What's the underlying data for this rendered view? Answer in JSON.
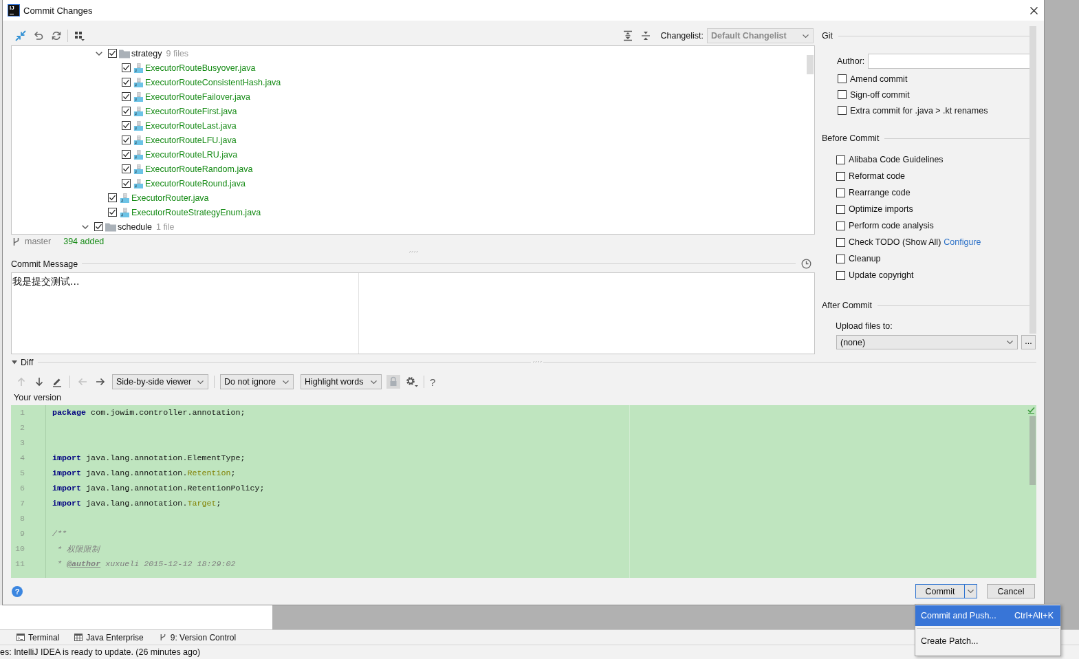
{
  "window": {
    "logo_text": "IJ",
    "title": "Commit Changes"
  },
  "changes": {
    "changelist_label": "Changelist:",
    "changelist": "Default Changelist",
    "tree": [
      {
        "children": [
          {
            "kind": "folder",
            "label": "strategy",
            "count": "9 files",
            "checked": true,
            "expanded": true,
            "children": [
              {
                "kind": "file",
                "label": "ExecutorRouteBusyover.java",
                "checked": true
              },
              {
                "kind": "file",
                "label": "ExecutorRouteConsistentHash.java",
                "checked": true
              },
              {
                "kind": "file",
                "label": "ExecutorRouteFailover.java",
                "checked": true
              },
              {
                "kind": "file",
                "label": "ExecutorRouteFirst.java",
                "checked": true
              },
              {
                "kind": "file",
                "label": "ExecutorRouteLast.java",
                "checked": true
              },
              {
                "kind": "file",
                "label": "ExecutorRouteLFU.java",
                "checked": true
              },
              {
                "kind": "file",
                "label": "ExecutorRouteLRU.java",
                "checked": true
              },
              {
                "kind": "file",
                "label": "ExecutorRouteRandom.java",
                "checked": true
              },
              {
                "kind": "file",
                "label": "ExecutorRouteRound.java",
                "checked": true
              }
            ]
          },
          {
            "kind": "file",
            "label": "ExecutorRouter.java",
            "checked": true
          },
          {
            "kind": "file",
            "label": "ExecutorRouteStrategyEnum.java",
            "checked": true
          }
        ]
      },
      {
        "kind": "folder",
        "label": "schedule",
        "count": "1 file",
        "checked": true,
        "expanded": true
      }
    ],
    "branch": "master",
    "summary": "394 added"
  },
  "commit_message": {
    "label": "Commit Message",
    "value": "我是提交测试..."
  },
  "git": {
    "title": "Git",
    "author_label": "Author:",
    "options": [
      {
        "label": "Amend commit",
        "checked": false
      },
      {
        "label": "Sign-off commit",
        "checked": false
      },
      {
        "label": "Extra commit for .java > .kt renames",
        "checked": false
      }
    ]
  },
  "before_commit": {
    "title": "Before Commit",
    "options": [
      {
        "label": "Alibaba Code Guidelines",
        "checked": false
      },
      {
        "label": "Reformat code",
        "checked": false
      },
      {
        "label": "Rearrange code",
        "checked": false
      },
      {
        "label": "Optimize imports",
        "checked": false
      },
      {
        "label": "Perform code analysis",
        "checked": false
      },
      {
        "label": "Check TODO (Show All)",
        "link": "Configure",
        "checked": false
      },
      {
        "label": "Cleanup",
        "checked": false
      },
      {
        "label": "Update copyright",
        "checked": false
      }
    ]
  },
  "after_commit": {
    "title": "After Commit",
    "upload_label": "Upload files to:",
    "upload_target": "(none)",
    "more_button": "..."
  },
  "diff": {
    "title": "Diff",
    "expanded": true,
    "nav": [
      {
        "kind": "up",
        "disabled": true
      },
      {
        "kind": "down",
        "disabled": false
      },
      {
        "kind": "edit",
        "disabled": false
      },
      {
        "kind": "left",
        "disabled": true
      },
      {
        "kind": "right",
        "disabled": false
      }
    ],
    "viewer": "Side-by-side viewer",
    "ignore": "Do not ignore",
    "highlight": "Highlight words",
    "lock": {
      "disabled": true
    },
    "help": "?",
    "version_label": "Your version",
    "lines": [
      {
        "number": "1",
        "tokens": [
          {
            "kind": "keyword",
            "text": "package"
          },
          {
            "kind": "plain",
            "text": " com.jowim.controller.annotation;"
          }
        ]
      },
      {
        "number": "2"
      },
      {
        "number": "3"
      },
      {
        "number": "4",
        "tokens": [
          {
            "kind": "keyword",
            "text": "import"
          },
          {
            "kind": "plain",
            "text": " java.lang.annotation.ElementType;"
          }
        ]
      },
      {
        "number": "5",
        "tokens": [
          {
            "kind": "keyword",
            "text": "import"
          },
          {
            "kind": "plain",
            "text": " java.lang.annotation."
          },
          {
            "kind": "type",
            "text": "Retention"
          },
          {
            "kind": "plain",
            "text": ";"
          }
        ]
      },
      {
        "number": "6",
        "tokens": [
          {
            "kind": "keyword",
            "text": "import"
          },
          {
            "kind": "plain",
            "text": " java.lang.annotation.RetentionPolicy;"
          }
        ]
      },
      {
        "number": "7",
        "tokens": [
          {
            "kind": "keyword",
            "text": "import"
          },
          {
            "kind": "plain",
            "text": " java.lang.annotation."
          },
          {
            "kind": "type",
            "text": "Target"
          },
          {
            "kind": "plain",
            "text": ";"
          }
        ]
      },
      {
        "number": "8"
      },
      {
        "number": "9",
        "tokens": [
          {
            "kind": "comment",
            "text": "/**"
          }
        ]
      },
      {
        "number": "10",
        "tokens": [
          {
            "kind": "comment",
            "text": " * 权限限制"
          }
        ]
      },
      {
        "number": "11",
        "tokens": [
          {
            "kind": "comment",
            "text": " * "
          },
          {
            "kind": "doctag",
            "text": "@author"
          },
          {
            "kind": "comment",
            "text": " xuxueli 2015-12-12 18:29:02"
          }
        ]
      }
    ]
  },
  "footer": {
    "help": "?",
    "buttons": [
      {
        "kind": "split",
        "label": "Commit",
        "default": true
      },
      {
        "kind": "plain",
        "label": "Cancel",
        "default": false
      }
    ]
  },
  "popup_menu": [
    {
      "label": "Commit and Push...",
      "shortcut": "Ctrl+Alt+K",
      "selected": true
    },
    {
      "label": "Create Patch...",
      "selected": false
    }
  ],
  "tool_windows": [
    {
      "kind": "terminal",
      "label": "Terminal"
    },
    {
      "kind": "java_enterprise",
      "label": "Java Enterprise"
    },
    {
      "kind": "version_control",
      "label": "9: Version Control"
    }
  ],
  "status_bar": {
    "message": "es: IntelliJ IDEA is ready to update. (26 minutes ago)"
  }
}
